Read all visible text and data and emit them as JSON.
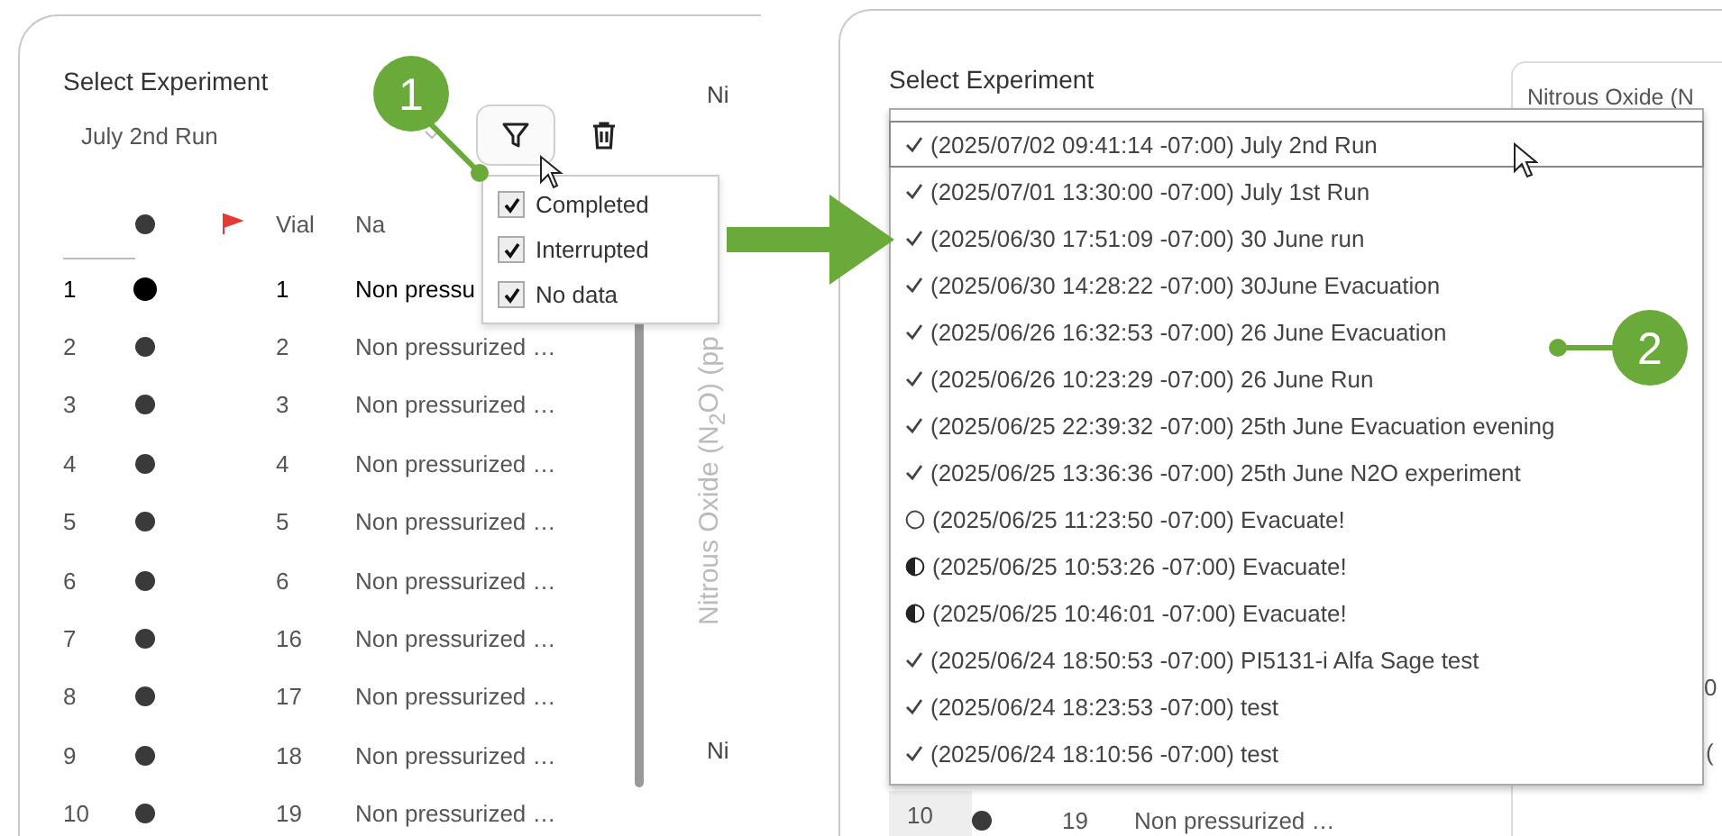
{
  "left_panel": {
    "title": "Select Experiment",
    "selected_experiment": "July 2nd Run",
    "chart_labels": [
      "Ni",
      "Ni"
    ],
    "axis_label": "Nitrous Oxide (N$_{2}$O) (pp",
    "table": {
      "columns": [
        "Vial",
        "Na"
      ],
      "rows": [
        {
          "index": "1",
          "vial": "1",
          "name": "Non pressu",
          "selected": true
        },
        {
          "index": "2",
          "vial": "2",
          "name": "Non pressurized …",
          "selected": false
        },
        {
          "index": "3",
          "vial": "3",
          "name": "Non pressurized …",
          "selected": false
        },
        {
          "index": "4",
          "vial": "4",
          "name": "Non pressurized …",
          "selected": false
        },
        {
          "index": "5",
          "vial": "5",
          "name": "Non pressurized …",
          "selected": false
        },
        {
          "index": "6",
          "vial": "6",
          "name": "Non pressurized …",
          "selected": false
        },
        {
          "index": "7",
          "vial": "16",
          "name": "Non pressurized …",
          "selected": false
        },
        {
          "index": "8",
          "vial": "17",
          "name": "Non pressurized …",
          "selected": false
        },
        {
          "index": "9",
          "vial": "18",
          "name": "Non pressurized …",
          "selected": false
        },
        {
          "index": "10",
          "vial": "19",
          "name": "Non pressurized …",
          "selected": false
        }
      ]
    },
    "filter_menu": [
      {
        "label": "Completed",
        "checked": true
      },
      {
        "label": "Interrupted",
        "checked": true
      },
      {
        "label": "No data",
        "checked": true
      }
    ]
  },
  "right_panel": {
    "title": "Select Experiment",
    "chart_title": "Nitrous Oxide (N",
    "chart_fragments": [
      "0",
      "("
    ],
    "experiments": [
      {
        "kind": "completed",
        "label": "(2025/07/02 09:41:14 -07:00) July 2nd Run",
        "selected": true
      },
      {
        "kind": "completed",
        "label": "(2025/07/01 13:30:00 -07:00) July 1st Run",
        "selected": false
      },
      {
        "kind": "completed",
        "label": "(2025/06/30 17:51:09 -07:00) 30 June run",
        "selected": false
      },
      {
        "kind": "completed",
        "label": "(2025/06/30 14:28:22 -07:00) 30June Evacuation",
        "selected": false
      },
      {
        "kind": "completed",
        "label": "(2025/06/26 16:32:53 -07:00) 26 June Evacuation",
        "selected": false
      },
      {
        "kind": "completed",
        "label": "(2025/06/26 10:23:29 -07:00) 26 June Run",
        "selected": false
      },
      {
        "kind": "completed",
        "label": "(2025/06/25 22:39:32 -07:00) 25th June Evacuation evening",
        "selected": false
      },
      {
        "kind": "completed",
        "label": "(2025/06/25 13:36:36 -07:00) 25th June N2O experiment",
        "selected": false
      },
      {
        "kind": "no_data",
        "label": "(2025/06/25 11:23:50 -07:00) Evacuate!",
        "selected": false
      },
      {
        "kind": "interrupted",
        "label": "(2025/06/25 10:53:26 -07:00) Evacuate!",
        "selected": false
      },
      {
        "kind": "interrupted",
        "label": "(2025/06/25 10:46:01 -07:00) Evacuate!",
        "selected": false
      },
      {
        "kind": "completed",
        "label": "(2025/06/24 18:50:53 -07:00) PI5131-i Alfa Sage test",
        "selected": false
      },
      {
        "kind": "completed",
        "label": "(2025/06/24 18:23:53 -07:00) test",
        "selected": false
      },
      {
        "kind": "completed",
        "label": "(2025/06/24 18:10:56 -07:00) test",
        "selected": false
      }
    ],
    "visible_row": {
      "index": "10",
      "vial": "19",
      "name": "Non pressurized …"
    }
  },
  "callouts": [
    "1",
    "2"
  ]
}
